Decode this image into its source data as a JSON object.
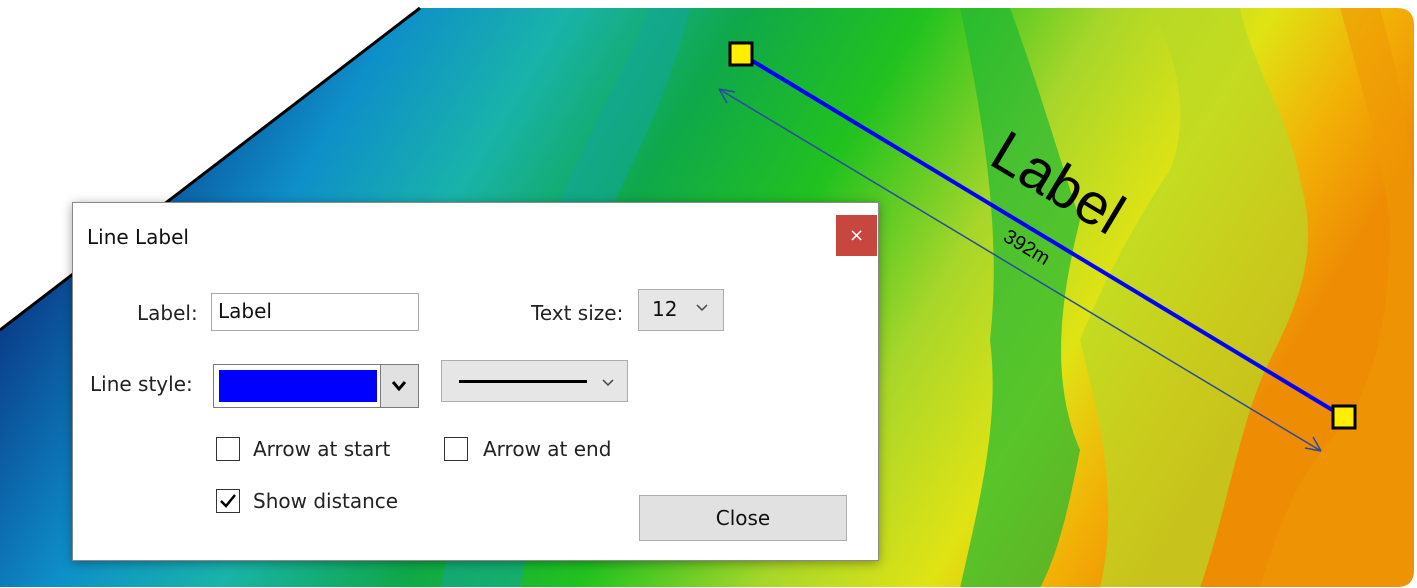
{
  "map": {
    "line_label": "Label",
    "distance": "392m",
    "line_color": "#0000ff",
    "endpoint_color": "#ffee00"
  },
  "dialog": {
    "title": "Line Label",
    "close_glyph": "×",
    "label_caption": "Label:",
    "label_value": "Label",
    "text_size_caption": "Text size:",
    "text_size_value": "12",
    "line_style_caption": "Line style:",
    "line_color": "#0000ff",
    "arrow_start_label": "Arrow at start",
    "arrow_start_checked": false,
    "arrow_end_label": "Arrow at end",
    "arrow_end_checked": false,
    "show_distance_label": "Show distance",
    "show_distance_checked": true,
    "close_button_label": "Close",
    "chevron_icon": "chevron-down-icon"
  }
}
